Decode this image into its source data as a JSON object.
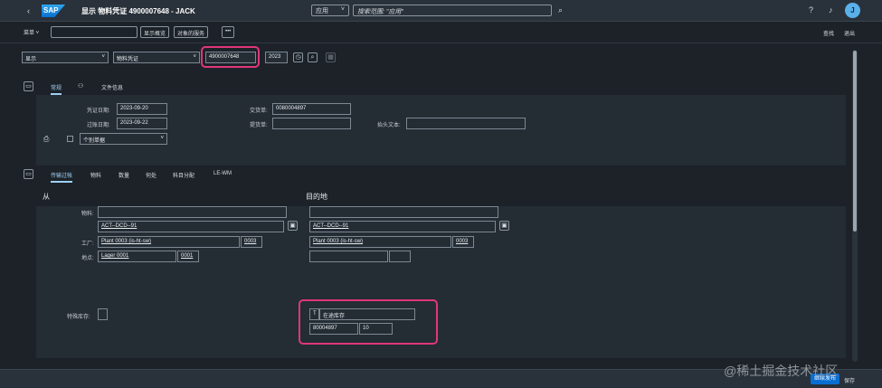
{
  "shell": {
    "title": "显示 物料凭证 4900007648 - JACK",
    "logo": "SAP",
    "scope_select": "应用",
    "search_placeholder": "搜索范围: \"应用\"",
    "avatar_initial": "J"
  },
  "toolbar": {
    "menu": "菜单",
    "show_overview": "显示概览",
    "object_services": "对象的服务",
    "more": "•••",
    "find": "查找",
    "exit": "退出"
  },
  "header": {
    "action": "显示",
    "doc_type": "物料凭证",
    "doc_number": "4900007648",
    "year": "2023"
  },
  "general": {
    "tabs": [
      "常规",
      "文件信息"
    ],
    "doc_date_label": "凭证日期:",
    "doc_date": "2023-09-20",
    "post_date_label": "过账日期:",
    "post_date": "2023-09-22",
    "delivery_note_label": "交货单:",
    "delivery_note": "0080004897",
    "bill_of_lading_label": "提货单:",
    "bill_of_lading": "",
    "header_text_label": "抬头文本:",
    "header_text": "",
    "slip_select": "个别单据"
  },
  "item": {
    "tabs": [
      "传输过帐",
      "物料",
      "数量",
      "何处",
      "科目分配",
      "LE-WM"
    ],
    "from_title": "从",
    "to_title": "目的地",
    "material_label": "物料:",
    "from_material_desc": "",
    "from_material": "ACT--DCD--91",
    "to_material_desc": "",
    "to_material": "ACT--DCD--91",
    "plant_label": "工厂:",
    "from_plant_name": "Plant 0003 (is-ht-sw)",
    "from_plant": "0003",
    "to_plant_name": "Plant 0003 (is-ht-sw)",
    "to_plant": "0003",
    "storage_label": "地点:",
    "from_storage_name": "Lager 0001",
    "from_storage": "0001",
    "to_storage_name": "",
    "to_storage": "",
    "special_stock_label": "特殊库存:",
    "special_stock": "",
    "to_special_code": "T",
    "to_special_desc": "在途库存",
    "to_delivery": "80004897",
    "to_delivery_item": "10"
  },
  "footer": {
    "save_label": "继续发布",
    "other_label": "保存"
  },
  "watermark": "@稀土掘金技术社区",
  "colors": {
    "highlight": "#e0367a",
    "accent": "#9fd0f5",
    "brand": "#0a6ed1"
  }
}
